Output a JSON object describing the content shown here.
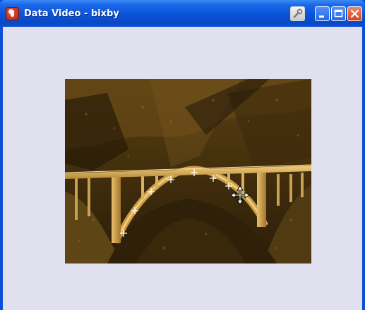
{
  "window": {
    "title": "Data Video - bixby",
    "icons": {
      "app": "app-logo-icon",
      "tool": "wrench-icon",
      "minimize": "minimize-icon",
      "maximize": "maximize-icon",
      "close": "close-icon"
    }
  },
  "colors": {
    "titlebar": "#0a54d8",
    "client_background": "#e1e0ee",
    "close_button": "#d8411c"
  },
  "video": {
    "content": "sepia photo of an arched concrete bridge spanning a rocky canyon",
    "markers": [
      {
        "label": "tracked-point",
        "kind": "crosshair"
      },
      {
        "label": "tracked-point",
        "kind": "crosshair"
      },
      {
        "label": "tracked-point",
        "kind": "crosshair"
      },
      {
        "label": "tracked-point",
        "kind": "crosshair"
      },
      {
        "label": "tracked-point",
        "kind": "crosshair"
      },
      {
        "label": "tracked-point",
        "kind": "crosshair"
      },
      {
        "label": "tracked-point",
        "kind": "crosshair"
      }
    ],
    "cursor": "move-cursor-icon"
  }
}
